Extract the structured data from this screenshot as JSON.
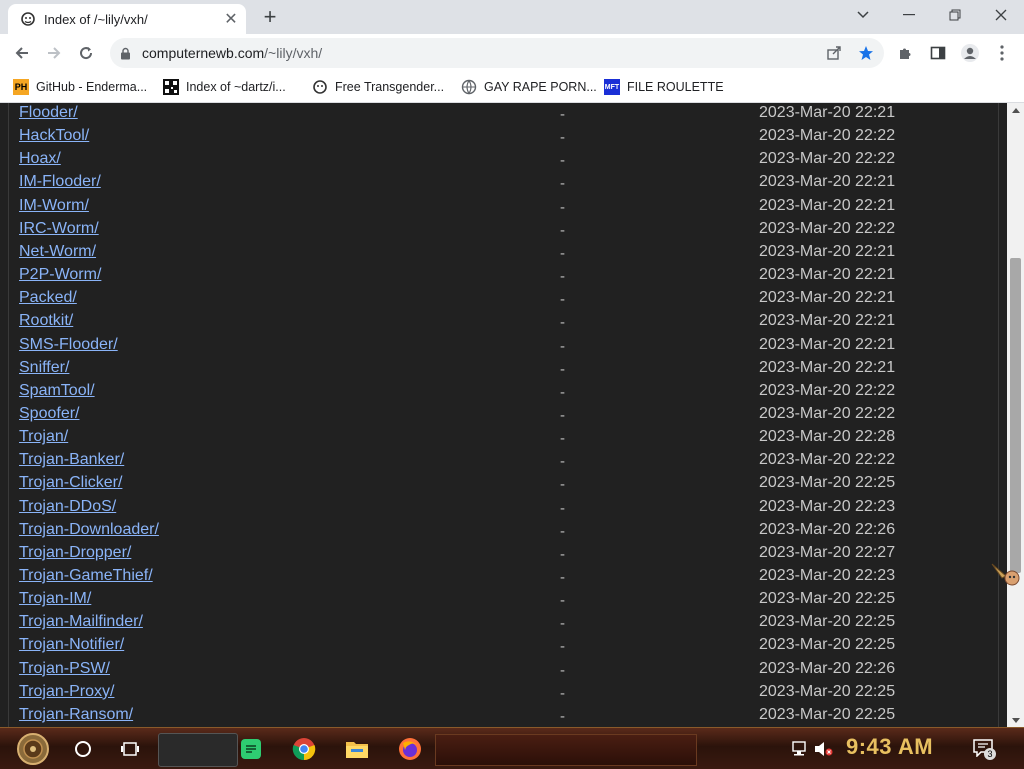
{
  "browser": {
    "tab": {
      "title": "Index of /~lily/vxh/",
      "favicon": "monkey-icon"
    },
    "address": {
      "domain": "computernewb.com",
      "path": "/~lily/vxh/"
    },
    "bookmarks": [
      {
        "label": "GitHub - Enderma...",
        "icon": "ph-icon",
        "icon_text": "PH"
      },
      {
        "label": "Index of ~dartz/i...",
        "icon": "qr-icon",
        "icon_text": ""
      },
      {
        "label": "Free Transgender...",
        "icon": "monkey-icon",
        "icon_text": ""
      },
      {
        "label": "GAY RAPE PORN...",
        "icon": "globe-icon",
        "icon_text": ""
      },
      {
        "label": "FILE ROULETTE",
        "icon": "mf-icon",
        "icon_text": "MFT"
      }
    ]
  },
  "listing": [
    {
      "name": "Flooder/",
      "size": "-",
      "date": "2023-Mar-20 22:21"
    },
    {
      "name": "HackTool/",
      "size": "-",
      "date": "2023-Mar-20 22:22"
    },
    {
      "name": "Hoax/",
      "size": "-",
      "date": "2023-Mar-20 22:22"
    },
    {
      "name": "IM-Flooder/",
      "size": "-",
      "date": "2023-Mar-20 22:21"
    },
    {
      "name": "IM-Worm/",
      "size": "-",
      "date": "2023-Mar-20 22:21"
    },
    {
      "name": "IRC-Worm/",
      "size": "-",
      "date": "2023-Mar-20 22:22"
    },
    {
      "name": "Net-Worm/",
      "size": "-",
      "date": "2023-Mar-20 22:21"
    },
    {
      "name": "P2P-Worm/",
      "size": "-",
      "date": "2023-Mar-20 22:21"
    },
    {
      "name": "Packed/",
      "size": "-",
      "date": "2023-Mar-20 22:21"
    },
    {
      "name": "Rootkit/",
      "size": "-",
      "date": "2023-Mar-20 22:21"
    },
    {
      "name": "SMS-Flooder/",
      "size": "-",
      "date": "2023-Mar-20 22:21"
    },
    {
      "name": "Sniffer/",
      "size": "-",
      "date": "2023-Mar-20 22:21"
    },
    {
      "name": "SpamTool/",
      "size": "-",
      "date": "2023-Mar-20 22:22"
    },
    {
      "name": "Spoofer/",
      "size": "-",
      "date": "2023-Mar-20 22:22"
    },
    {
      "name": "Trojan/",
      "size": "-",
      "date": "2023-Mar-20 22:28"
    },
    {
      "name": "Trojan-Banker/",
      "size": "-",
      "date": "2023-Mar-20 22:22"
    },
    {
      "name": "Trojan-Clicker/",
      "size": "-",
      "date": "2023-Mar-20 22:25"
    },
    {
      "name": "Trojan-DDoS/",
      "size": "-",
      "date": "2023-Mar-20 22:23"
    },
    {
      "name": "Trojan-Downloader/",
      "size": "-",
      "date": "2023-Mar-20 22:26"
    },
    {
      "name": "Trojan-Dropper/",
      "size": "-",
      "date": "2023-Mar-20 22:27"
    },
    {
      "name": "Trojan-GameThief/",
      "size": "-",
      "date": "2023-Mar-20 22:23"
    },
    {
      "name": "Trojan-IM/",
      "size": "-",
      "date": "2023-Mar-20 22:25"
    },
    {
      "name": "Trojan-Mailfinder/",
      "size": "-",
      "date": "2023-Mar-20 22:25"
    },
    {
      "name": "Trojan-Notifier/",
      "size": "-",
      "date": "2023-Mar-20 22:25"
    },
    {
      "name": "Trojan-PSW/",
      "size": "-",
      "date": "2023-Mar-20 22:26"
    },
    {
      "name": "Trojan-Proxy/",
      "size": "-",
      "date": "2023-Mar-20 22:25"
    },
    {
      "name": "Trojan-Ransom/",
      "size": "-",
      "date": "2023-Mar-20 22:25"
    }
  ],
  "taskbar": {
    "clock": "9:43 AM",
    "notification_count": "3",
    "pinned": [
      "cortana-icon",
      "task-view-icon",
      "notes-app-icon",
      "chrome-icon",
      "file-explorer-icon",
      "firefox-icon"
    ],
    "tray": [
      "network-icon",
      "volume-muted-icon",
      "notification-center-icon"
    ]
  },
  "colors": {
    "link": "#8ab4f8",
    "page_bg": "#212121",
    "clock": "#e8c060",
    "bookmark_star": "#1a73e8"
  }
}
